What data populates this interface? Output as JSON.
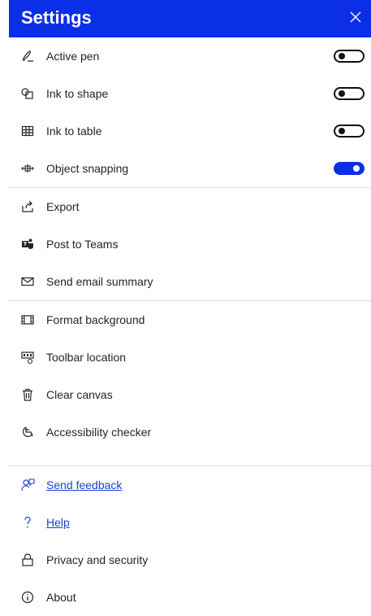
{
  "header": {
    "title": "Settings",
    "close_icon": "close-icon"
  },
  "toggles": [
    {
      "label": "Active pen",
      "icon": "pen-icon",
      "on": false
    },
    {
      "label": "Ink to shape",
      "icon": "shape-icon",
      "on": false
    },
    {
      "label": "Ink to table",
      "icon": "table-icon",
      "on": false
    },
    {
      "label": "Object snapping",
      "icon": "snapping-icon",
      "on": true
    }
  ],
  "actions": [
    {
      "label": "Export",
      "icon": "export-icon"
    },
    {
      "label": "Post to Teams",
      "icon": "teams-icon"
    },
    {
      "label": "Send email summary",
      "icon": "mail-icon"
    }
  ],
  "canvas": [
    {
      "label": "Format background",
      "icon": "background-icon"
    },
    {
      "label": "Toolbar location",
      "icon": "toolbar-location-icon"
    },
    {
      "label": "Clear canvas",
      "icon": "trash-icon"
    },
    {
      "label": "Accessibility checker",
      "icon": "accessibility-icon"
    }
  ],
  "support": [
    {
      "label": "Send feedback",
      "icon": "feedback-icon",
      "link": true
    },
    {
      "label": "Help",
      "icon": "help-icon",
      "link": true
    },
    {
      "label": "Privacy and security",
      "icon": "lock-icon",
      "link": false
    },
    {
      "label": "About",
      "icon": "info-icon",
      "link": false
    }
  ],
  "colors": {
    "accent": "#0b2fe6",
    "link": "#1a3fd9",
    "divider": "#e1dfdd"
  }
}
